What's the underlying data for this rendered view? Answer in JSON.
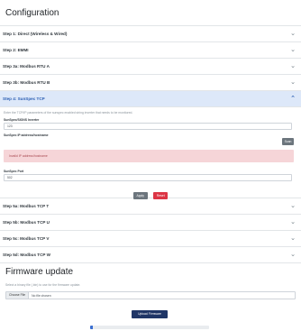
{
  "config": {
    "title": "Configuration",
    "steps_top": [
      {
        "label": "Step 1: Direct (Wireless & Wired)"
      },
      {
        "label": "Step 2: EMMI"
      },
      {
        "label": "Step 3a: Modbus RTU A"
      },
      {
        "label": "Step 3b: Modbus RTU B"
      }
    ],
    "active_step": {
      "label": "Step 4: SunSpec TCP",
      "hint": "Enter the TCP/IP parameters of the sunspec enabled string inverter that needs to be monitored.",
      "host_label": "SunSpec/SIONS Inverter",
      "host_value": "123",
      "ip_label": "SunSpec IP address/hostname",
      "scan_button": "Scan",
      "alert": "Invalid IP address/hostname",
      "port_label": "SunSpec Port",
      "port_value": "502",
      "apply_button": "Apply",
      "reset_button": "Reset"
    },
    "steps_bottom": [
      {
        "label": "Step 5a: Modbus TCP T"
      },
      {
        "label": "Step 5b: Modbus TCP U"
      },
      {
        "label": "Step 5c: Modbus TCP V"
      },
      {
        "label": "Step 5d: Modbus TCP W"
      }
    ]
  },
  "firmware": {
    "title": "Firmware update",
    "description": "Select a binary file (.bin) to use for the firmware update.",
    "choose_file_button": "Choose File",
    "file_status": "No file chosen",
    "upload_button": "Upload Firmware",
    "progress": 0.02
  },
  "colors": {
    "active_step_bg": "#dde8f9",
    "alert_bg": "#f6d5d8",
    "reset_button": "#dc3545",
    "upload_button": "#1f3566"
  },
  "icons": {
    "collapsed": "chevron-down-icon",
    "expanded": "chevron-up-icon"
  }
}
